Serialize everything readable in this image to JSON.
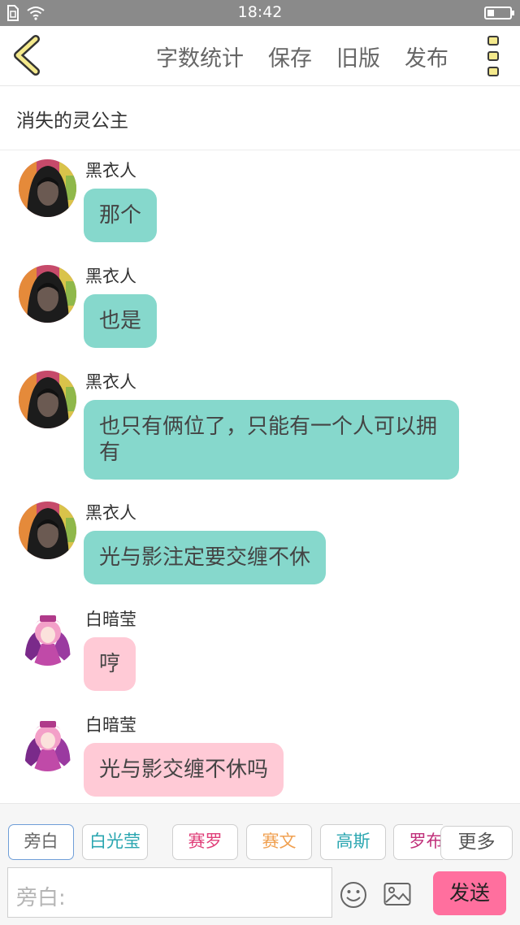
{
  "status_bar": {
    "time": "18:42",
    "battery_level": 0.3
  },
  "nav": {
    "actions": [
      "字数统计",
      "保存",
      "旧版",
      "发布"
    ]
  },
  "story": {
    "title": "消失的灵公主"
  },
  "messages": [
    {
      "speaker": "黑衣人",
      "text": "那个",
      "style": "teal",
      "avatar": "hooded-figure-avatar"
    },
    {
      "speaker": "黑衣人",
      "text": "也是",
      "style": "teal",
      "avatar": "hooded-figure-avatar"
    },
    {
      "speaker": "黑衣人",
      "text": "也只有俩位了，只能有一个人可以拥有",
      "style": "teal",
      "avatar": "hooded-figure-avatar"
    },
    {
      "speaker": "黑衣人",
      "text": "光与影注定要交缠不休",
      "style": "teal",
      "avatar": "hooded-figure-avatar"
    },
    {
      "speaker": "白暗莹",
      "text": "哼",
      "style": "pink",
      "avatar": "pink-hair-girl-avatar"
    },
    {
      "speaker": "白暗莹",
      "text": "光与影交缠不休吗",
      "style": "pink",
      "avatar": "pink-hair-girl-avatar"
    }
  ],
  "characters": [
    {
      "label": "旁白",
      "color": "#666666"
    },
    {
      "label": "白光莹",
      "color": "#2aa6b0"
    },
    {
      "label": "赛罗",
      "color": "#e0407a"
    },
    {
      "label": "赛文",
      "color": "#f0a050"
    },
    {
      "label": "高斯",
      "color": "#2aa6b0"
    },
    {
      "label": "罗布",
      "color": "#c0307a"
    }
  ],
  "more_label": "更多",
  "input": {
    "placeholder": "旁白:"
  },
  "send_label": "发送",
  "colors": {
    "teal_bubble": "#86d8cc",
    "pink_bubble": "#ffcad6",
    "send_button": "#ff6f9e",
    "status_bar": "#8a8a8a",
    "menu_dot_fill": "#f4e98c"
  }
}
